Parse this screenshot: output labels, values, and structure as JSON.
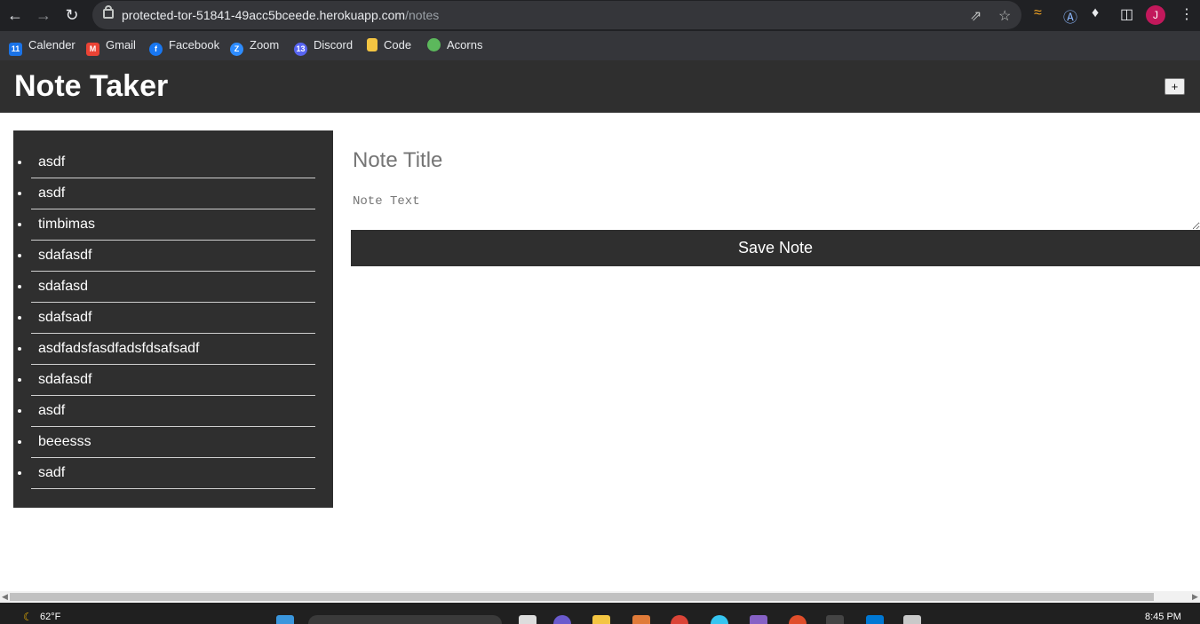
{
  "browser": {
    "url_host": "protected-tor-51841-49acc5bceede.herokuapp.com",
    "url_path": "/notes",
    "avatar_letter": "J",
    "bookmarks": [
      {
        "label": "Calender",
        "icon": "calendar-icon",
        "color": "#1a73e8",
        "glyph": "11"
      },
      {
        "label": "Gmail",
        "icon": "gmail-icon",
        "color": "#ea4335",
        "glyph": "M"
      },
      {
        "label": "Facebook",
        "icon": "facebook-icon",
        "color": "#1877f2",
        "glyph": "f"
      },
      {
        "label": "Zoom",
        "icon": "zoom-icon",
        "color": "#2d8cff",
        "glyph": "Z"
      },
      {
        "label": "Discord",
        "icon": "discord-icon",
        "color": "#5865f2",
        "glyph": "13"
      },
      {
        "label": "Code",
        "icon": "folder-icon",
        "color": "#f4c542",
        "glyph": ""
      },
      {
        "label": "Acorns",
        "icon": "acorns-icon",
        "color": "#5cb85c",
        "glyph": ""
      }
    ]
  },
  "header": {
    "title": "Note Taker",
    "new_note_label": "+"
  },
  "notes": [
    "asdf",
    "asdf",
    "timbimas",
    "sdafasdf",
    "sdafasd",
    "sdafsadf",
    "asdfadsfasdfadsfdsafsadf",
    "sdafasdf",
    "asdf",
    "beeesss",
    "sadf"
  ],
  "editor": {
    "title_placeholder": "Note Title",
    "text_placeholder": "Note Text",
    "save_label": "Save Note"
  },
  "taskbar": {
    "weather": "62°F",
    "time": "8:45 PM"
  },
  "colors": {
    "header_bg": "#2f2f2f",
    "sidebar_bg": "#2f2f2f",
    "save_bg": "#2f2f2f"
  }
}
